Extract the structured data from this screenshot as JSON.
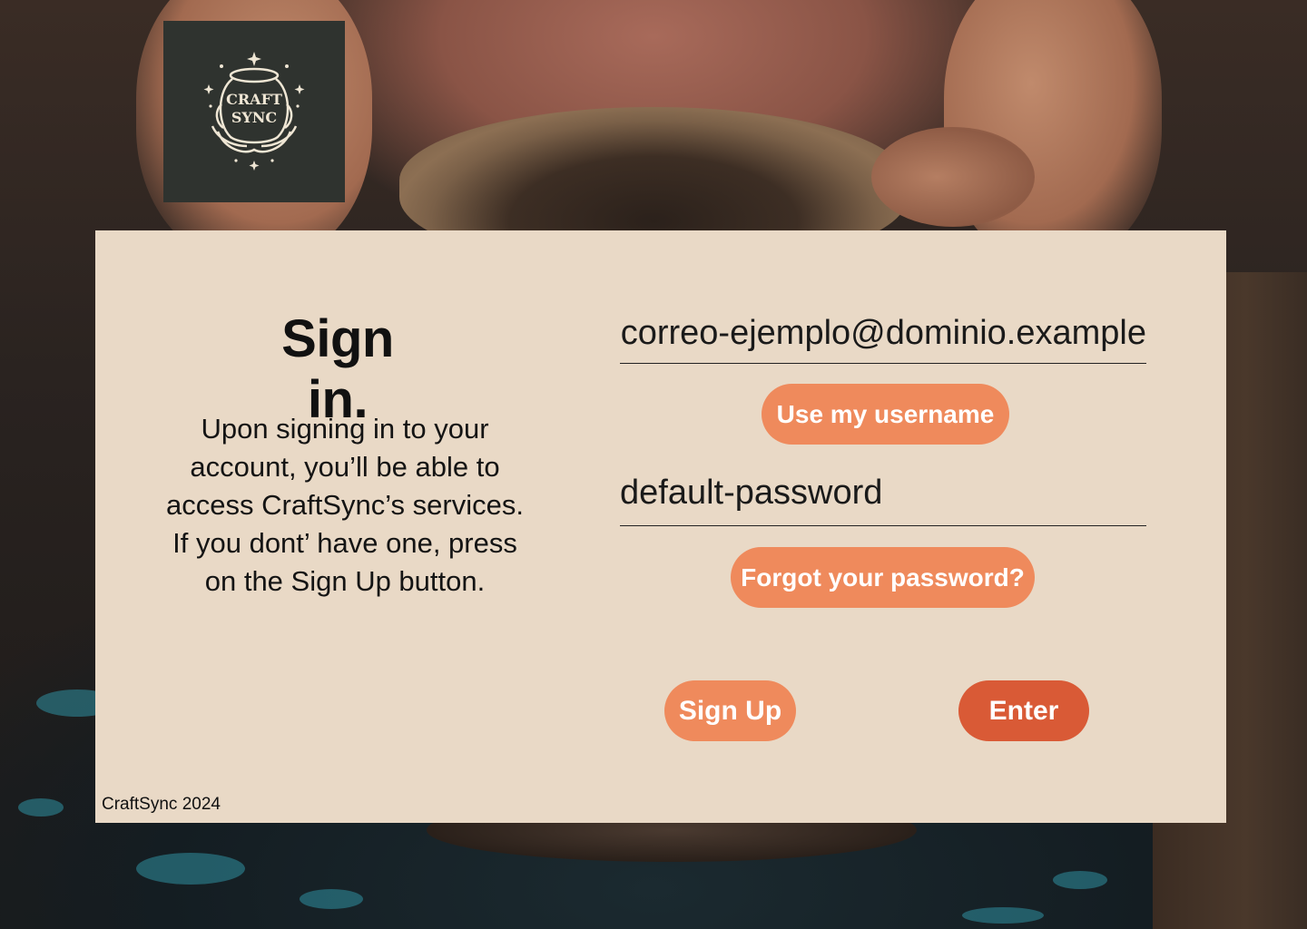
{
  "brand": {
    "logo_line1": "CRAFT",
    "logo_line2": "SYNC"
  },
  "signin": {
    "title": "Sign in.",
    "description": "Upon signing in to your account, you’ll be able to access CraftSync’s services. If you dont’ have one, press on the Sign Up button."
  },
  "form": {
    "email_value": "correo-ejemplo@dominio.example",
    "use_username_label": "Use my username",
    "password_value": "default-password",
    "forgot_password_label": "Forgot your password?",
    "signup_label": "Sign Up",
    "enter_label": "Enter"
  },
  "footer": {
    "text": "CraftSync 2024"
  },
  "colors": {
    "card_bg": "#e9d9c6",
    "button_light": "#ef8a5c",
    "button_dark": "#d95a36",
    "logo_bg": "#2f332f"
  }
}
